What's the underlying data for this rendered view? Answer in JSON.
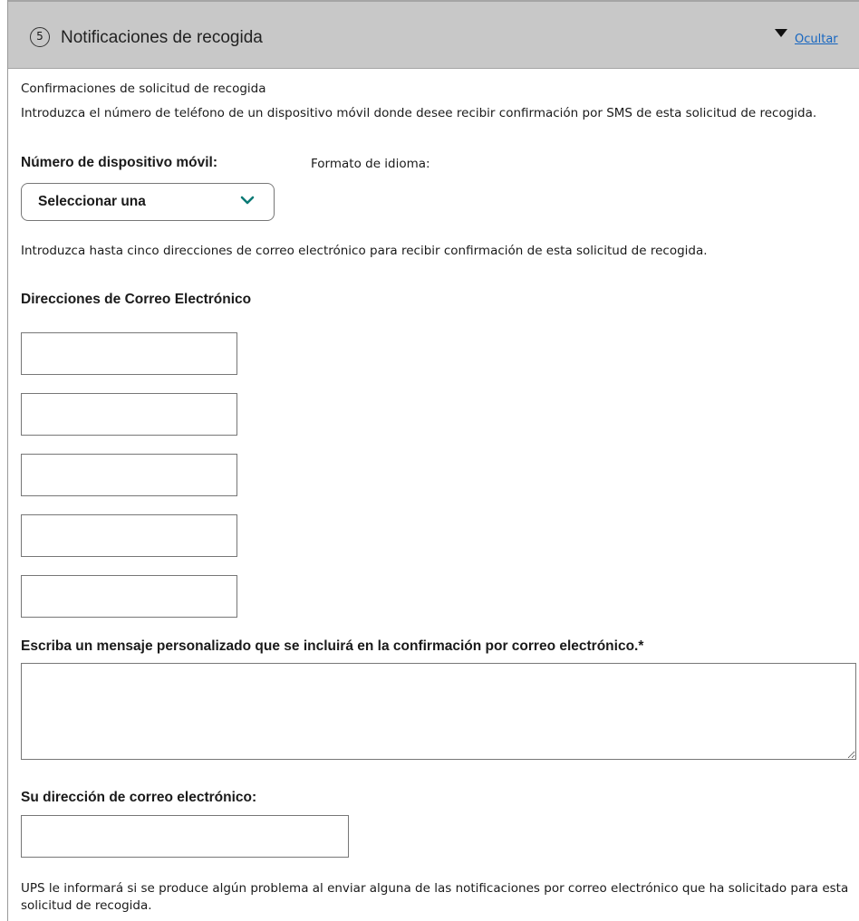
{
  "section": {
    "step_number": "5",
    "title": "Notificaciones de recogida",
    "hide_link": "Ocultar"
  },
  "sms": {
    "heading": "Confirmaciones de solicitud de recogida",
    "instructions": "Introduzca el número de teléfono de un dispositivo móvil donde desee recibir confirmación por SMS de esta solicitud de recogida.",
    "mobile_label": "Número de dispositivo móvil:",
    "language_label": "Formato de idioma:",
    "select_value": "Seleccionar una"
  },
  "email": {
    "instructions": "Introduzca hasta cinco direcciones de correo electrónico para recibir confirmación de esta solicitud de recogida.",
    "addresses_label": "Direcciones de Correo Electrónico",
    "addresses": [
      "",
      "",
      "",
      "",
      ""
    ]
  },
  "message": {
    "label": "Escriba un mensaje personalizado que se incluirá en la confirmación por correo electrónico.*",
    "value": ""
  },
  "your_email": {
    "label": "Su dirección de correo electrónico:",
    "value": ""
  },
  "footer_note": "UPS le informará si se produce algún problema al enviar alguna de las notificaciones por correo electrónico que ha solicitado para esta solicitud de recogida.",
  "colors": {
    "header_bg": "#c8c8c8",
    "link": "#1565c0",
    "chevron": "#0b7a75"
  }
}
